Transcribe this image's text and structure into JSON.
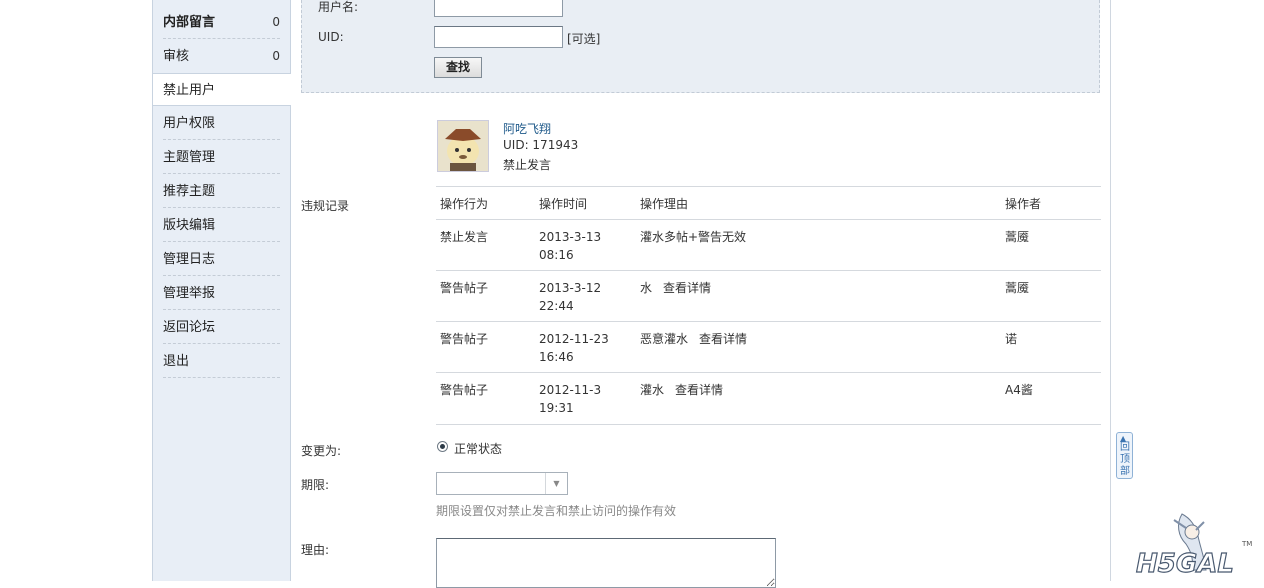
{
  "sidebar": {
    "items": [
      {
        "label": "内部留言",
        "count": "0"
      },
      {
        "label": "审核",
        "count": "0"
      },
      {
        "label": "禁止用户"
      },
      {
        "label": "用户权限"
      },
      {
        "label": "主题管理"
      },
      {
        "label": "推荐主题"
      },
      {
        "label": "版块编辑"
      },
      {
        "label": "管理日志"
      },
      {
        "label": "管理举报"
      },
      {
        "label": "返回论坛"
      },
      {
        "label": "退出"
      }
    ]
  },
  "search": {
    "username_label": "用户名:",
    "username_value": "",
    "uid_label": "UID:",
    "uid_value": "",
    "uid_hint": "[可选]",
    "find_button": "查找"
  },
  "user": {
    "name": "阿吃飞翔",
    "uid": "UID: 171943",
    "status": "禁止发言"
  },
  "violations": {
    "section_label": "违规记录",
    "headers": [
      "操作行为",
      "操作时间",
      "操作理由",
      "操作者"
    ],
    "rows": [
      {
        "action": "禁止发言",
        "date": "2013-3-13",
        "time": "08:16",
        "reason": "灌水多帖+警告无效",
        "detail": "",
        "operator": "蒿魇"
      },
      {
        "action": "警告帖子",
        "date": "2013-3-12",
        "time": "22:44",
        "reason": "水",
        "detail": "查看详情",
        "operator": "蒿魇"
      },
      {
        "action": "警告帖子",
        "date": "2012-11-23",
        "time": "16:46",
        "reason": "恶意灌水",
        "detail": "查看详情",
        "operator": "诺"
      },
      {
        "action": "警告帖子",
        "date": "2012-11-3",
        "time": "19:31",
        "reason": "灌水",
        "detail": "查看详情",
        "operator": "A4酱"
      }
    ]
  },
  "form": {
    "change_label": "变更为:",
    "normal_status": "正常状态",
    "period_label": "期限:",
    "period_value": "",
    "period_hint": "期限设置仅对禁止发言和禁止访问的操作有效",
    "reason_label": "理由:",
    "reason_value": ""
  },
  "back_to_top": {
    "label": "回顶部",
    "icon": "arrow-up-icon"
  },
  "logo": {
    "text": "H5GAL",
    "tm": "TM"
  },
  "colors": {
    "sidebar_bg": "#e8eef6",
    "search_bg": "#e9eef4",
    "link": "#1f5a8a"
  }
}
